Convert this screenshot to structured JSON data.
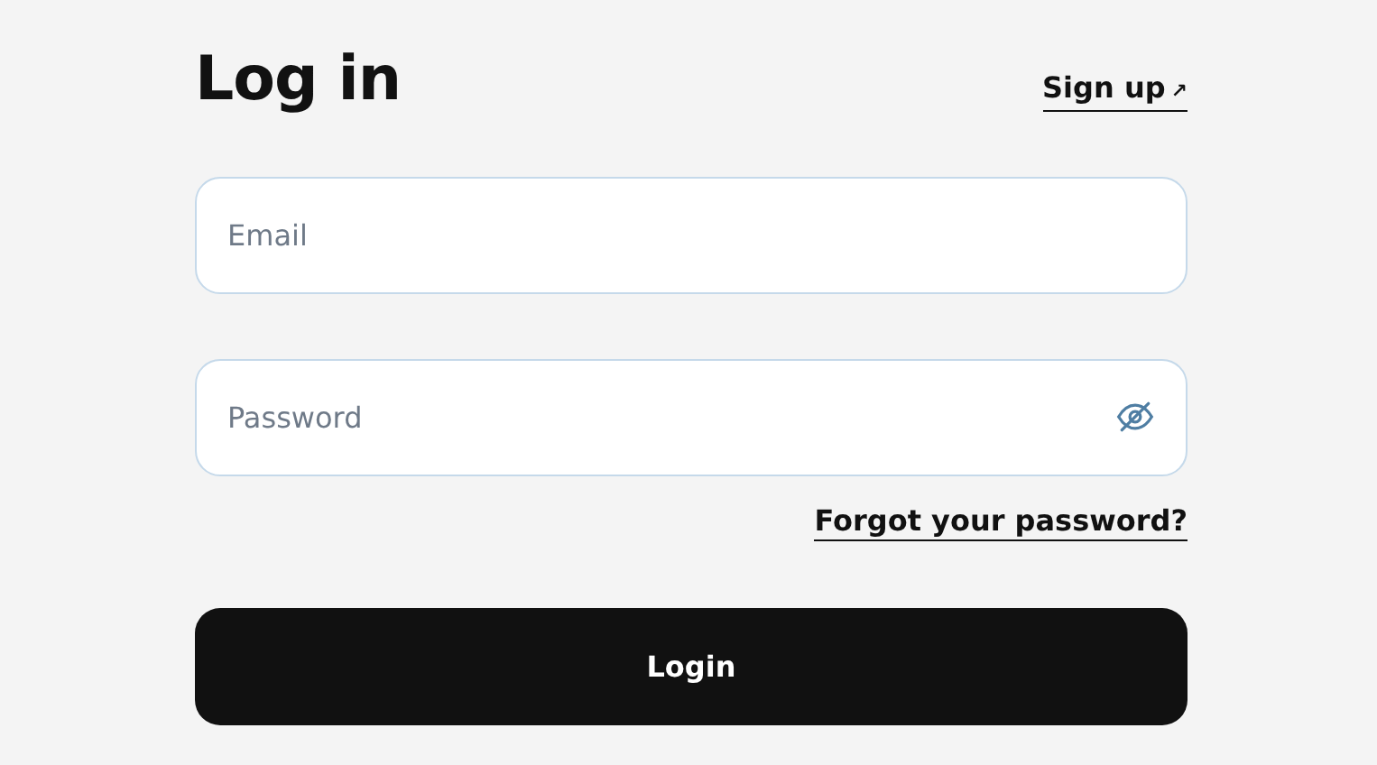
{
  "title": "Log in",
  "signup_link": {
    "label": "Sign up",
    "arrow": "↗"
  },
  "fields": [
    {
      "kind": "text",
      "placeholder": "Email"
    },
    {
      "kind": "password",
      "placeholder": "Password"
    }
  ],
  "forgot_link": "Forgot your password?",
  "submit_button": "Login"
}
